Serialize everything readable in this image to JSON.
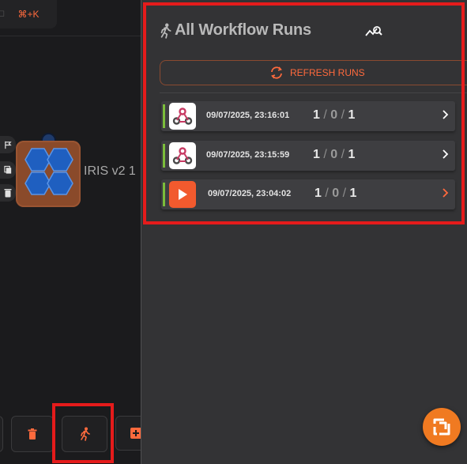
{
  "canvas": {
    "shortcut_label": "⌘+K",
    "shortcut_prefix_glyph": "◻",
    "node": {
      "label": "IRIS v2 1",
      "icon": "hexagon-cluster-icon"
    },
    "node_tools": [
      "flag-icon",
      "copy-icon",
      "trash-icon"
    ],
    "toolbar": [
      "panel-left-icon",
      "trash-icon",
      "running-person-icon",
      "add-box-icon"
    ]
  },
  "panel": {
    "title": "All Workflow Runs",
    "title_icon": "running-person-icon",
    "insight_icon": "chart-search-icon",
    "refresh_label": "REFRESH RUNS",
    "runs": [
      {
        "timestamp": "09/07/2025, 23:16:01",
        "success": "1",
        "failed": "0",
        "total": "1",
        "icon": "webhook-icon",
        "chevron_color": "#ffffff"
      },
      {
        "timestamp": "09/07/2025, 23:15:59",
        "success": "1",
        "failed": "0",
        "total": "1",
        "icon": "webhook-icon",
        "chevron_color": "#ffffff"
      },
      {
        "timestamp": "09/07/2025, 23:04:02",
        "success": "1",
        "failed": "0",
        "total": "1",
        "icon": "play-icon",
        "chevron_color": "#ff6a3d"
      }
    ]
  },
  "colors": {
    "accent": "#ff6a3d",
    "status_ok": "#7bbd3a",
    "highlight": "#e51b1b",
    "fab": "#f07a21"
  },
  "fab_icon": "shuffle-logo-icon"
}
